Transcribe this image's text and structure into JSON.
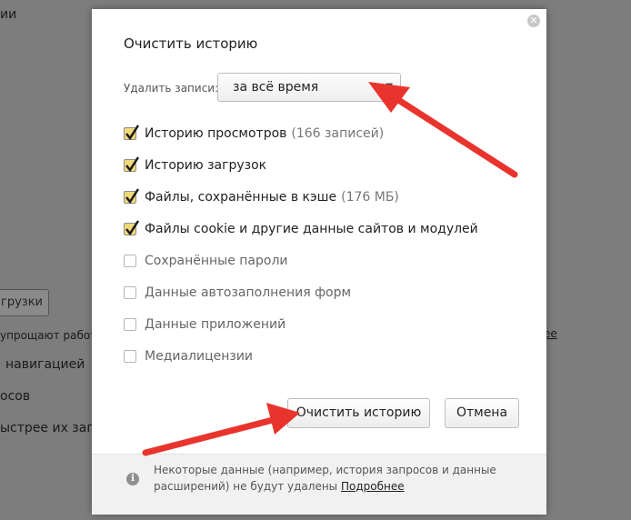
{
  "background": {
    "fragments": [
      "ии",
      "грузки",
      "упрощают работ",
      "навигацией",
      "осов",
      "ыстрее их загр"
    ],
    "button_label": "грузки",
    "link": "ее"
  },
  "dialog": {
    "title": "Очистить историю",
    "period": {
      "label": "Удалить записи:",
      "value": "за всё время"
    },
    "options": [
      {
        "label": "Историю просмотров",
        "count": "(166 записей)",
        "checked": true
      },
      {
        "label": "Историю загрузок",
        "count": "",
        "checked": true
      },
      {
        "label": "Файлы, сохранённые в кэше",
        "count": "(176 МБ)",
        "checked": true
      },
      {
        "label": "Файлы cookie и другие данные сайтов и модулей",
        "count": "",
        "checked": true
      },
      {
        "label": "Сохранённые пароли",
        "count": "",
        "checked": false
      },
      {
        "label": "Данные автозаполнения форм",
        "count": "",
        "checked": false
      },
      {
        "label": "Данные приложений",
        "count": "",
        "checked": false
      },
      {
        "label": "Медиалицензии",
        "count": "",
        "checked": false
      }
    ],
    "buttons": {
      "clear": "Очистить историю",
      "cancel": "Отмена"
    },
    "footer": {
      "text": "Некоторые данные (например, история запросов и данные расширений) не будут удалены",
      "link": "Подробнее"
    }
  },
  "colors": {
    "arrow": "#e8342c",
    "checkmark": "#1a1a1a",
    "checkbox_fill": "#f0d97a"
  },
  "icons": [
    "close-icon",
    "chevron-down-icon",
    "checkmark-icon",
    "info-icon",
    "arrow-annotation"
  ]
}
